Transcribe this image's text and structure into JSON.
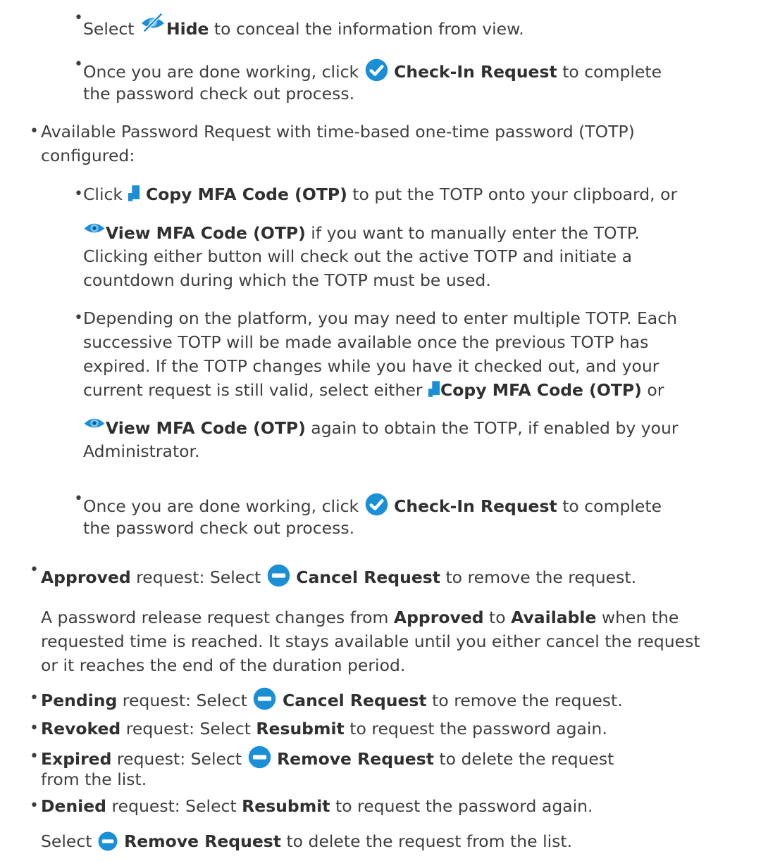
{
  "items": {
    "hide": {
      "pre": "Select ",
      "bold": "Hide",
      "post": " to conceal the information from view."
    },
    "checkin1": {
      "pre": "Once you are done working, click ",
      "bold": "Check-In Request",
      "post": " to complete",
      "cont": "the password check out process."
    },
    "totp": {
      "line1": "Available Password Request with time-based one-time password (TOTP)",
      "line2": "configured:"
    },
    "copy": {
      "pre": "Click ",
      "bold": "Copy MFA Code (OTP)",
      "post": " to put the TOTP onto your clipboard, or"
    },
    "view": {
      "bold": "View MFA Code (OTP)",
      "post": " if you want to manually enter the TOTP.",
      "line2": "Clicking either button will check out the active TOTP and initiate a",
      "line3": "countdown during which the TOTP must be used."
    },
    "multi": {
      "line1": "Depending on the platform, you may need to enter multiple TOTP. Each",
      "line2": "successive TOTP will be made available once the previous TOTP has",
      "line3": "expired. If the TOTP changes while you have it checked out, and your",
      "line4_pre": "current request is still valid, select either ",
      "line4_bold": "Copy MFA Code (OTP)",
      "line4_post": " or",
      "line5_bold": "View MFA Code (OTP)",
      "line5_post": " again to obtain the TOTP, if enabled by your",
      "line6": "Administrator."
    },
    "checkin2": {
      "pre": "Once you are done working, click ",
      "bold": "Check-In Request",
      "post": " to complete",
      "cont": "the password check out process."
    },
    "approved": {
      "bold": "Approved",
      "mid": " request: Select ",
      "bold2": "Cancel Request",
      "post": " to remove the request.",
      "p_pre": "A password release request changes from ",
      "p_b1": "Approved",
      "p_mid": " to ",
      "p_b2": "Available",
      "p_post": " when the",
      "p_line2": "requested time is reached. It stays available until you either cancel the request",
      "p_line3": "or it reaches the end of the duration period."
    },
    "pending": {
      "bold": "Pending",
      "mid": " request: Select ",
      "bold2": "Cancel Request",
      "post": " to remove the request."
    },
    "revoked": {
      "bold": "Revoked",
      "mid": " request: Select ",
      "bold2": "Resubmit",
      "post": " to request the password again."
    },
    "expired": {
      "bold": "Expired",
      "mid": " request: Select ",
      "bold2": "Remove Request",
      "post": " to delete the request",
      "cont": "from the list."
    },
    "denied": {
      "bold": "Denied",
      "mid": " request: Select ",
      "bold2": "Resubmit",
      "post": " to request the password again.",
      "p_pre": "Select ",
      "p_bold": "Remove Request",
      "p_post": " to delete the request from the list."
    }
  },
  "colors": {
    "check": "#1a8fd6",
    "minus": "#1a8fd6",
    "copy": "#1a8fd6",
    "text": "#3e3e3e"
  }
}
